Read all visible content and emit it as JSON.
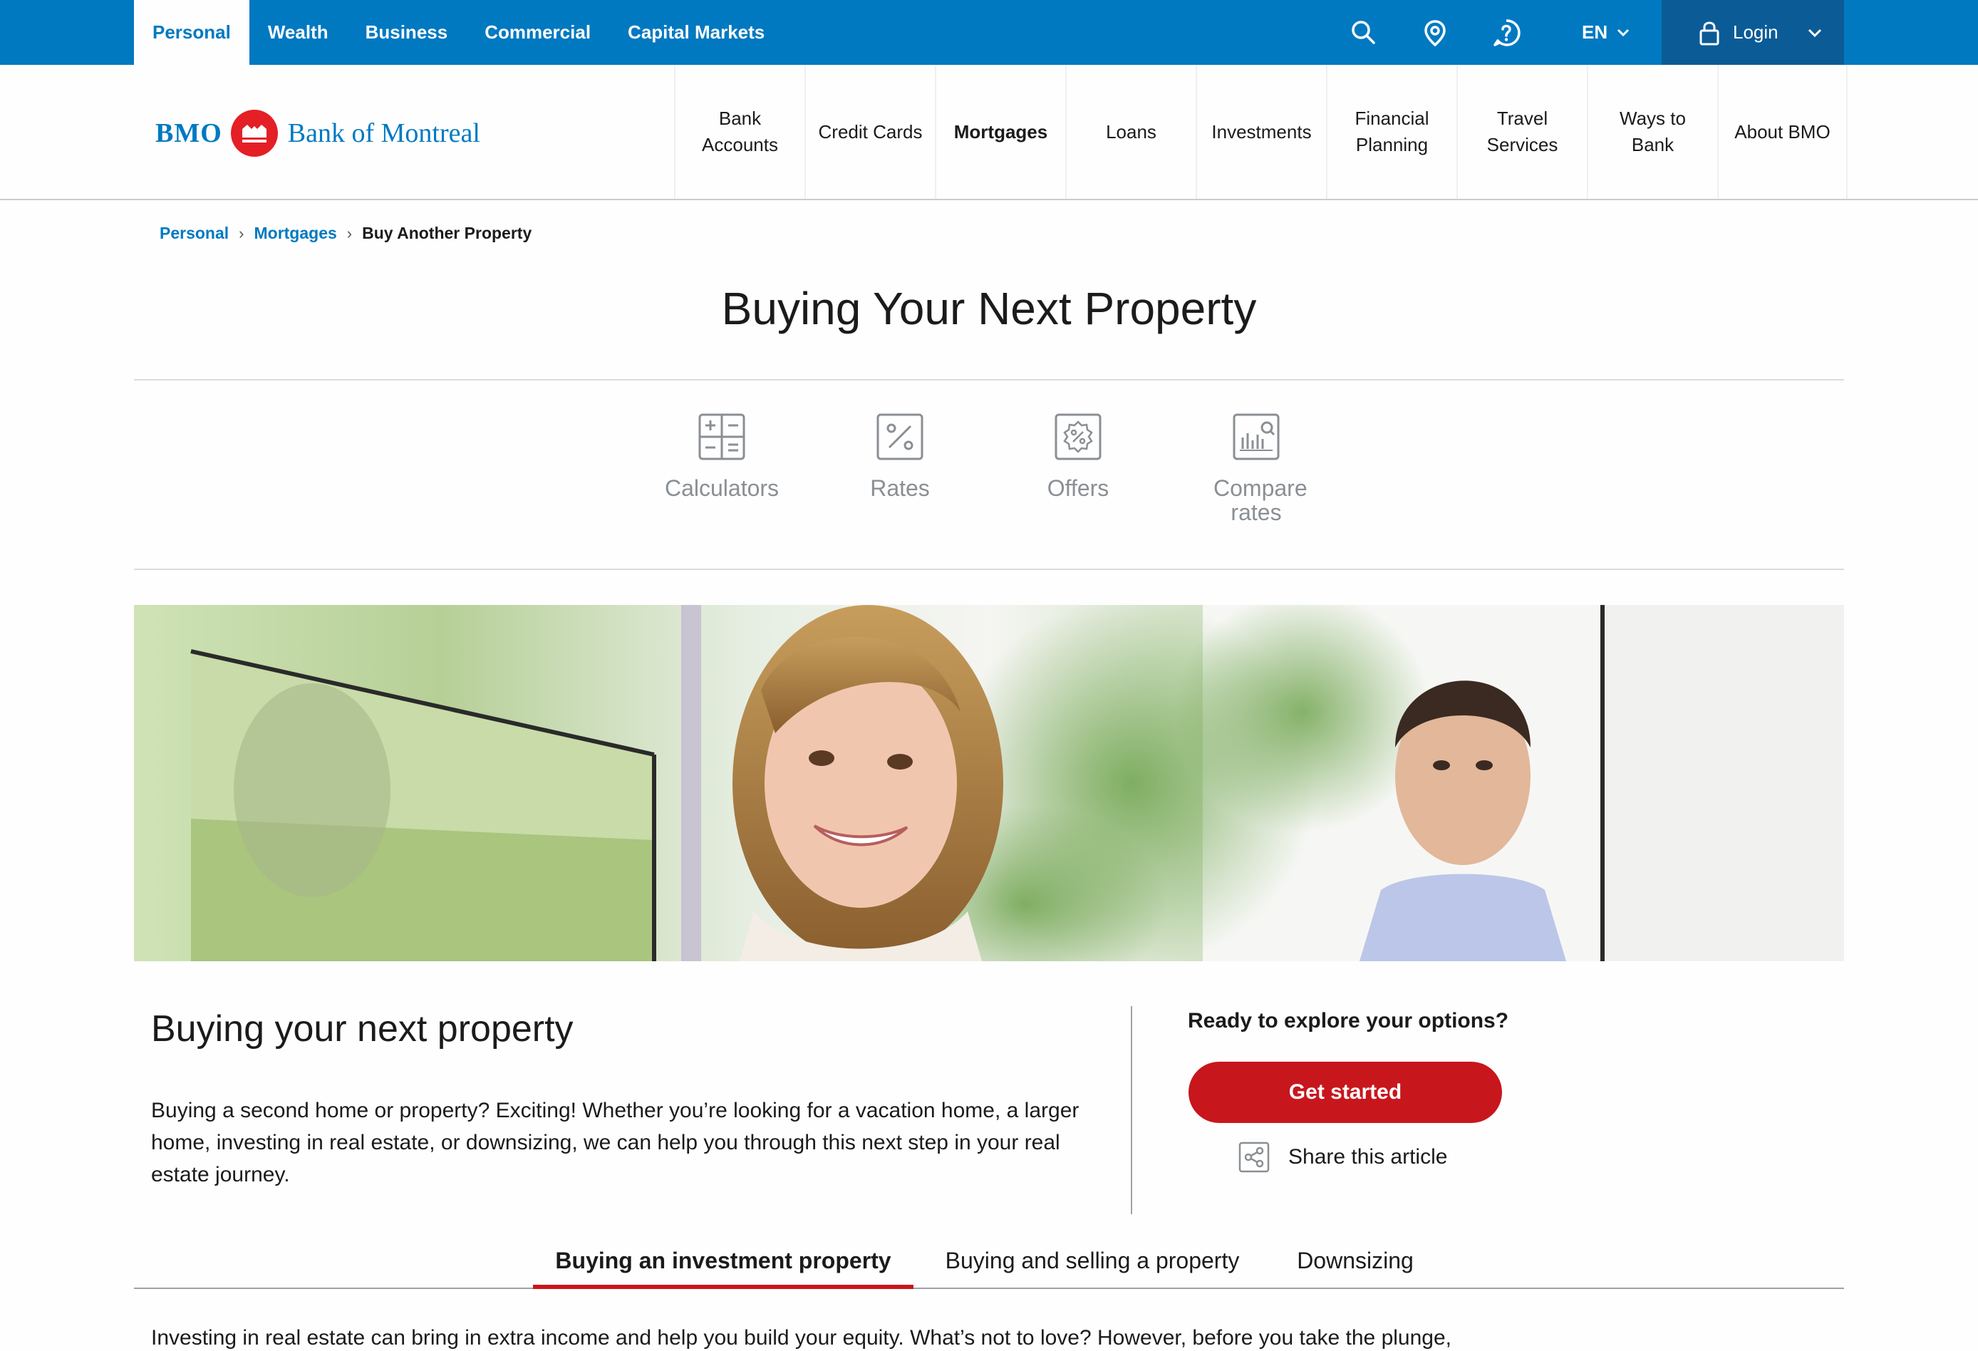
{
  "top_nav": {
    "items": [
      {
        "label": "Personal",
        "active": true
      },
      {
        "label": "Wealth"
      },
      {
        "label": "Business"
      },
      {
        "label": "Commercial"
      },
      {
        "label": "Capital Markets"
      }
    ],
    "language": "EN",
    "login_label": "Login",
    "tools": [
      "search-icon",
      "location-pin-icon",
      "help-icon"
    ]
  },
  "brand": {
    "short": "BMO",
    "name": "Bank of Montreal",
    "primary_color": "#0079c1",
    "accent_red": "#e41f26"
  },
  "main_nav": {
    "items": [
      {
        "label": "Bank Accounts"
      },
      {
        "label": "Credit Cards"
      },
      {
        "label": "Mortgages",
        "active": true
      },
      {
        "label": "Loans"
      },
      {
        "label": "Investments"
      },
      {
        "label": "Financial Planning"
      },
      {
        "label": "Travel Services"
      },
      {
        "label": "Ways to Bank"
      },
      {
        "label": "About BMO"
      }
    ]
  },
  "breadcrumb": {
    "items": [
      "Personal",
      "Mortgages"
    ],
    "current": "Buy Another Property"
  },
  "page": {
    "title": "Buying Your Next Property"
  },
  "quick_links": [
    {
      "label": "Calculators",
      "icon": "calculator-icon"
    },
    {
      "label": "Rates",
      "icon": "percent-icon"
    },
    {
      "label": "Offers",
      "icon": "offer-badge-icon"
    },
    {
      "label": "Compare rates",
      "icon": "compare-chart-icon"
    }
  ],
  "content": {
    "heading": "Buying your next property",
    "intro": "Buying a second home or property? Exciting! Whether you’re looking for a vacation home, a larger home, investing in real estate, or downsizing, we can help you through this next step in your real estate journey."
  },
  "sidebar": {
    "prompt": "Ready to explore your options?",
    "cta_label": "Get started",
    "cta_color": "#c8161d",
    "share_label": "Share this article"
  },
  "tabs": {
    "items": [
      {
        "label": "Buying an investment property",
        "active": true
      },
      {
        "label": "Buying and selling a property"
      },
      {
        "label": "Downsizing"
      }
    ]
  },
  "tab_content": {
    "text": "Investing in real estate can bring in extra income and help you build your equity. What’s not to love? However, before you take the plunge,"
  }
}
